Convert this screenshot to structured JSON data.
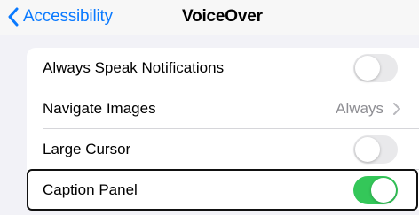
{
  "nav": {
    "back_label": "Accessibility",
    "title": "VoiceOver",
    "back_icon": "chevron-left-icon",
    "accent_color": "#0a7aff"
  },
  "settings": {
    "rows": [
      {
        "label": "Always Speak Notifications",
        "type": "toggle",
        "on": false
      },
      {
        "label": "Navigate Images",
        "type": "disclosure",
        "value": "Always"
      },
      {
        "label": "Large Cursor",
        "type": "toggle",
        "on": false
      },
      {
        "label": "Caption Panel",
        "type": "toggle",
        "on": true
      }
    ],
    "toggle_on_color": "#34c759",
    "toggle_off_color": "#e9e9eb",
    "focused_row": "Caption Panel"
  }
}
